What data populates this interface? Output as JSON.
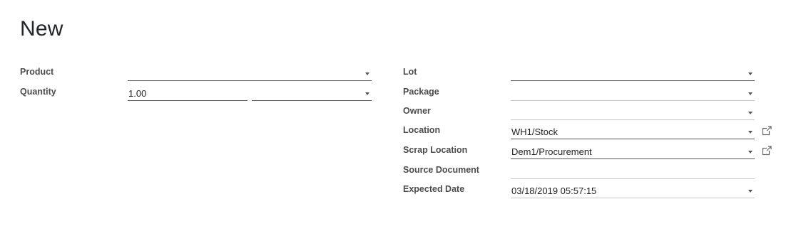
{
  "page": {
    "title": "New"
  },
  "left": {
    "product": {
      "label": "Product",
      "value": ""
    },
    "quantity": {
      "label": "Quantity",
      "value": "1.00",
      "uom_value": ""
    }
  },
  "right": {
    "lot": {
      "label": "Lot",
      "value": ""
    },
    "package": {
      "label": "Package",
      "value": ""
    },
    "owner": {
      "label": "Owner",
      "value": ""
    },
    "location": {
      "label": "Location",
      "value": "WH1/Stock",
      "link_icon": "external-link-icon"
    },
    "scrap_location": {
      "label": "Scrap Location",
      "value": "Dem1/Procurement",
      "link_icon": "external-link-icon"
    },
    "source_document": {
      "label": "Source Document",
      "value": ""
    },
    "expected_date": {
      "label": "Expected Date",
      "value": "03/18/2019 05:57:15"
    }
  }
}
